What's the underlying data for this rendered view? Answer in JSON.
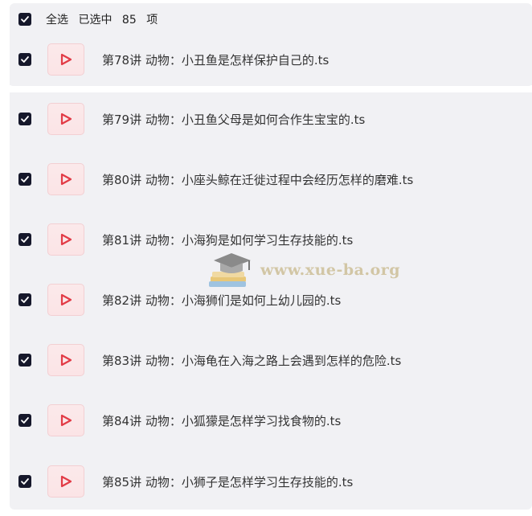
{
  "header": {
    "select_all": "全选",
    "selected_prefix": "已选中",
    "count": "85",
    "unit": "项"
  },
  "rows": [
    {
      "name": "第78讲 动物：小丑鱼是怎样保护自己的.ts"
    },
    {
      "name": "第79讲 动物：小丑鱼父母是如何合作生宝宝的.ts"
    },
    {
      "name": "第80讲 动物：小座头鲸在迁徙过程中会经历怎样的磨难.ts"
    },
    {
      "name": "第81讲 动物：小海狗是如何学习生存技能的.ts"
    },
    {
      "name": "第82讲 动物：小海狮们是如何上幼儿园的.ts"
    },
    {
      "name": "第83讲 动物：小海龟在入海之路上会遇到怎样的危险.ts"
    },
    {
      "name": "第84讲 动物：小狐獴是怎样学习找食物的.ts"
    },
    {
      "name": "第85讲 动物：小狮子是怎样学习生存技能的.ts"
    }
  ],
  "watermark": {
    "text": "www.xue-ba.org"
  },
  "colors": {
    "checkbox": "#16182b",
    "play_icon": "#e23b46",
    "row_bg": "#f1f1f4"
  }
}
